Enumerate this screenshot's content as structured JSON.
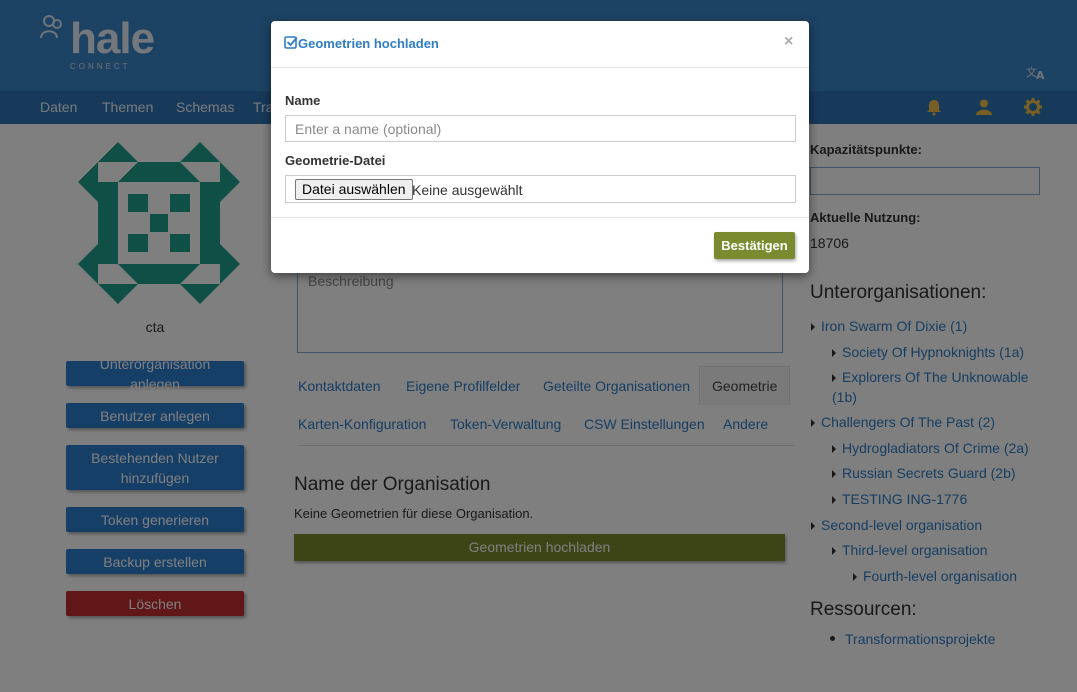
{
  "header": {
    "logo_text": "hale",
    "logo_sub": "CONNECT",
    "lang_icon": "translate-icon"
  },
  "nav": {
    "items": [
      "Daten",
      "Themen",
      "Schemas",
      "Tra"
    ],
    "icons": [
      "bell-icon",
      "user-icon",
      "gear-icon"
    ]
  },
  "left": {
    "org_short": "cta",
    "buttons": [
      "Unterorganisation anlegen",
      "Benutzer anlegen",
      "Bestehenden Nutzer hinzufügen",
      "Token generieren",
      "Backup erstellen",
      "Löschen"
    ]
  },
  "main": {
    "description_placeholder": "Beschreibung",
    "tabs": [
      "Kontaktdaten",
      "Eigene Profilfelder",
      "Geteilte Organisationen",
      "Geometrie",
      "Karten-Konfiguration",
      "Token-Verwaltung",
      "CSW Einstellungen",
      "Andere"
    ],
    "active_tab": "Geometrie",
    "section_title": "Name der Organisation",
    "section_text": "Keine Geometrien für diese Organisation.",
    "upload_button": "Geometrien hochladen"
  },
  "right": {
    "capacity_label": "Kapazitätspunkte:",
    "usage_label": "Aktuelle Nutzung:",
    "usage_value": "18706",
    "suborgs_heading": "Unterorganisationen:",
    "suborgs": [
      {
        "label": "Iron Swarm Of Dixie (1)"
      },
      {
        "label": "Society Of Hypnoknights (1a)"
      },
      {
        "label": "Explorers Of The Unknowable"
      },
      {
        "label": "(1b)"
      },
      {
        "label": "Challengers Of The Past (2)"
      },
      {
        "label": "Hydrogladiators Of Crime (2a)"
      },
      {
        "label": "Russian Secrets Guard (2b)"
      },
      {
        "label": "TESTING ING-1776"
      },
      {
        "label": "Second-level organisation"
      },
      {
        "label": "Third-level organisation"
      },
      {
        "label": "Fourth-level organisation"
      }
    ],
    "resources_heading": "Ressourcen:",
    "resources": [
      "Transformationsprojekte"
    ]
  },
  "modal": {
    "title": "Geometrien hochladen",
    "close": "×",
    "name_label": "Name",
    "name_placeholder": "Enter a name (optional)",
    "file_label": "Geometrie-Datei",
    "file_button": "Datei auswählen",
    "file_status": "Keine ausgewählt",
    "confirm": "Bestätigen"
  },
  "colors": {
    "header": "#3b87c8",
    "navbar": "#2f74b5",
    "primary_button": "#2d7fd1",
    "danger_button": "#c32f2f",
    "confirm_button": "#7a8a2f",
    "link": "#2f7dc4",
    "avatar_teal": "#1e9e8b"
  }
}
